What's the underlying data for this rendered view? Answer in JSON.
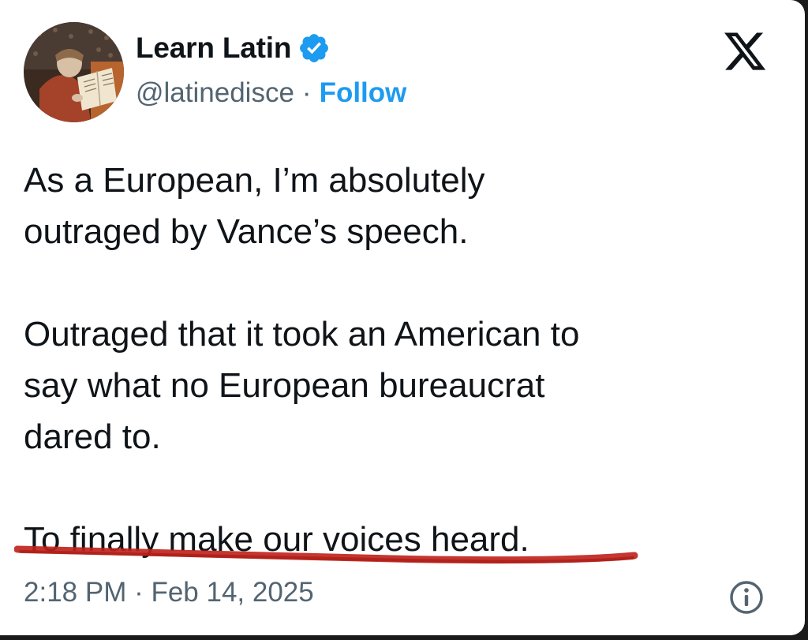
{
  "author": {
    "display_name": "Learn Latin",
    "handle": "@latinedisce",
    "separator": "·",
    "follow_label": "Follow",
    "verified_icon": "verified-badge-icon",
    "avatar": "medieval-scribe-illustration"
  },
  "platform_icon": "x-logo-icon",
  "tweet": {
    "paragraphs": [
      [
        "As a European, I’m absolutely",
        "outraged by Vance’s speech."
      ],
      [
        "Outraged that it took an American to",
        "say what no European bureaucrat",
        "dared to."
      ],
      [
        "To finally make our voices heard."
      ]
    ],
    "highlight": "red-hand-drawn-underline"
  },
  "timestamp": "2:18 PM · Feb 14, 2025",
  "info_icon": "info-icon",
  "colors": {
    "text": "#0f1419",
    "secondary_text": "#536471",
    "link": "#1d9bf0",
    "verified": "#1d9bf0",
    "underline": "#c0201a"
  }
}
